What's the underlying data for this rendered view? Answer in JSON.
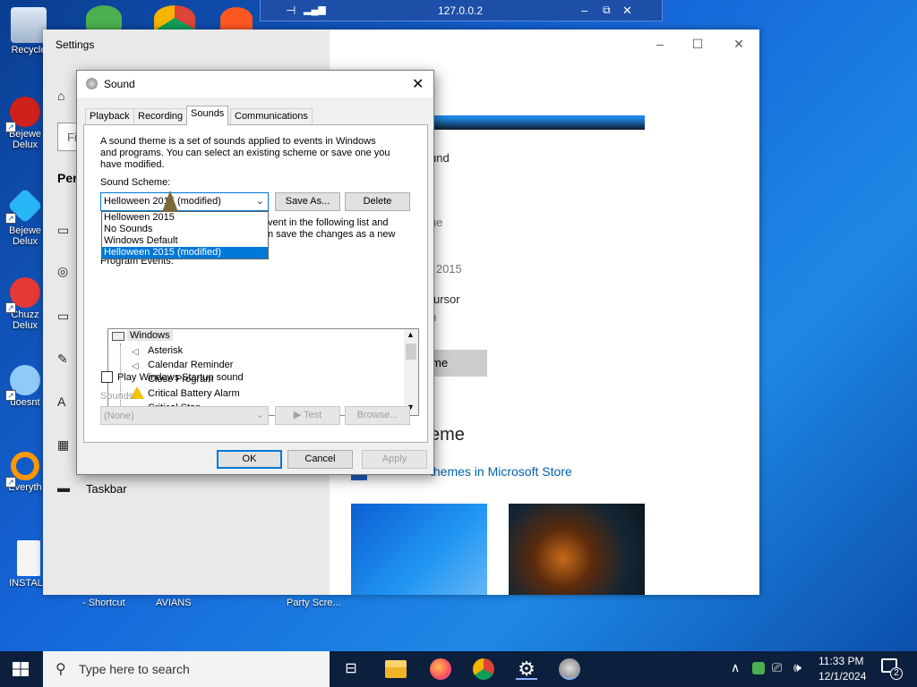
{
  "desktop": {
    "icons": [
      {
        "label": "Recycle"
      },
      {
        "label": "Bejewe Delux"
      },
      {
        "label": "Bejewe Delux"
      },
      {
        "label": "Chuzz Delux"
      },
      {
        "label": "doesnt"
      },
      {
        "label": "Everyth"
      },
      {
        "label": "INSTALL"
      }
    ],
    "bottom_labels": [
      "- Shortcut",
      "AVIANS",
      "Party Scre..."
    ]
  },
  "remote_bar": {
    "ip": "127.0.0.2"
  },
  "settings": {
    "title": "Settings",
    "search_placeholder": "Fi",
    "section": "Pers",
    "taskbar_item": "Taskbar",
    "right": {
      "snd": "und",
      "ue": "ue",
      "year": "n 2015",
      "cursor": "ursor",
      "n": "n",
      "me": "me",
      "heading": "eme",
      "store_link": "themes in Microsoft Store"
    }
  },
  "sound_dialog": {
    "title": "Sound",
    "tabs": [
      "Playback",
      "Recording",
      "Sounds",
      "Communications"
    ],
    "active_tab": "Sounds",
    "description": [
      "A sound theme is a set of sounds applied to events in Windows",
      "and programs.  You can select an existing scheme or save one you",
      "have modified."
    ],
    "scheme_label": "Sound Scheme:",
    "scheme_value": "Helloween 2015 (modified)",
    "save_as": "Save As...",
    "delete": "Delete",
    "dropdown_options": [
      "Helloween 2015",
      "No Sounds",
      "Windows Default",
      "Helloween 2015 (modified)"
    ],
    "selected_option": "Helloween 2015 (modified)",
    "hidden_text": [
      "vent in the following list and",
      "n save the changes as a new"
    ],
    "program_events_label": "Program Events:",
    "events": [
      "Windows",
      "Asterisk",
      "Calendar Reminder",
      "Close Program",
      "Critical Battery Alarm",
      "Critical Stop"
    ],
    "startup_checkbox": "Play Windows Startup sound",
    "startup_checked": false,
    "sounds_label": "Sounds:",
    "sounds_value": "(None)",
    "test": "Test",
    "browse": "Browse...",
    "ok": "OK",
    "cancel": "Cancel",
    "apply": "Apply"
  },
  "taskbar": {
    "search_placeholder": "Type here to search",
    "time": "11:33 PM",
    "date": "12/1/2024",
    "notification_count": "2"
  },
  "colors": {
    "accent": "#0078d7",
    "taskbar": "#0c1f3c"
  }
}
